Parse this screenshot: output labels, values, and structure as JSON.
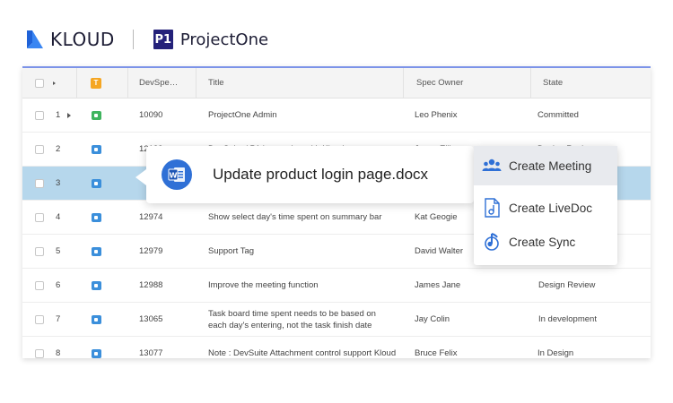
{
  "header": {
    "brand_kloud": "KLOUD",
    "brand_projectone": "ProjectOne",
    "projectone_mark": "P1"
  },
  "table": {
    "columns": {
      "type_badge": "T",
      "id": "DevSpe…",
      "title": "Title",
      "owner": "Spec Owner",
      "state": "State"
    },
    "rows": [
      {
        "num": "1",
        "id": "10090",
        "title": "ProjectOne Admin",
        "owner": "Leo Phenix",
        "state": "Committed",
        "icon": "green",
        "expand": true
      },
      {
        "num": "2",
        "id": "12123",
        "title": "DevSuite / P1 integration with Kloudsync",
        "owner": "Jason Ellis",
        "state": "Design Review",
        "icon": "blue",
        "expand": false
      },
      {
        "num": "3",
        "id": "",
        "title": "",
        "owner": "",
        "state": "",
        "icon": "blue",
        "expand": false
      },
      {
        "num": "4",
        "id": "12974",
        "title": "Show select day's time spent on summary bar",
        "owner": "Kat Geogie",
        "state": "",
        "icon": "blue",
        "expand": false
      },
      {
        "num": "5",
        "id": "12979",
        "title": "Support Tag",
        "owner": "David Walter",
        "state": "",
        "icon": "blue",
        "expand": false
      },
      {
        "num": "6",
        "id": "12988",
        "title": "Improve the meeting function",
        "owner": "James Jane",
        "state": "Design Review",
        "icon": "blue",
        "expand": false
      },
      {
        "num": "7",
        "id": "13065",
        "title": "Task board time spent needs to be based on each day's entering, not the task finish date",
        "owner": "Jay Colin",
        "state": "In development",
        "icon": "blue",
        "expand": false
      },
      {
        "num": "8",
        "id": "13077",
        "title": "Note :  DevSuite Attachment control support Kloud",
        "owner": "Bruce Felix",
        "state": "In Design",
        "icon": "blue",
        "expand": false
      }
    ]
  },
  "file_popup": {
    "file_name": "Update product login page.docx",
    "file_icon": "word-icon"
  },
  "action_menu": {
    "items": [
      {
        "label": "Create Meeting",
        "icon": "people-icon"
      },
      {
        "label": "Create LiveDoc",
        "icon": "document-icon"
      },
      {
        "label": "Create Sync",
        "icon": "sync-music-icon"
      }
    ]
  },
  "colors": {
    "accent": "#2f70d6",
    "highlight_row": "#b6d7ec",
    "projectone_brand": "#24217a",
    "type_badge": "#f5a623"
  }
}
